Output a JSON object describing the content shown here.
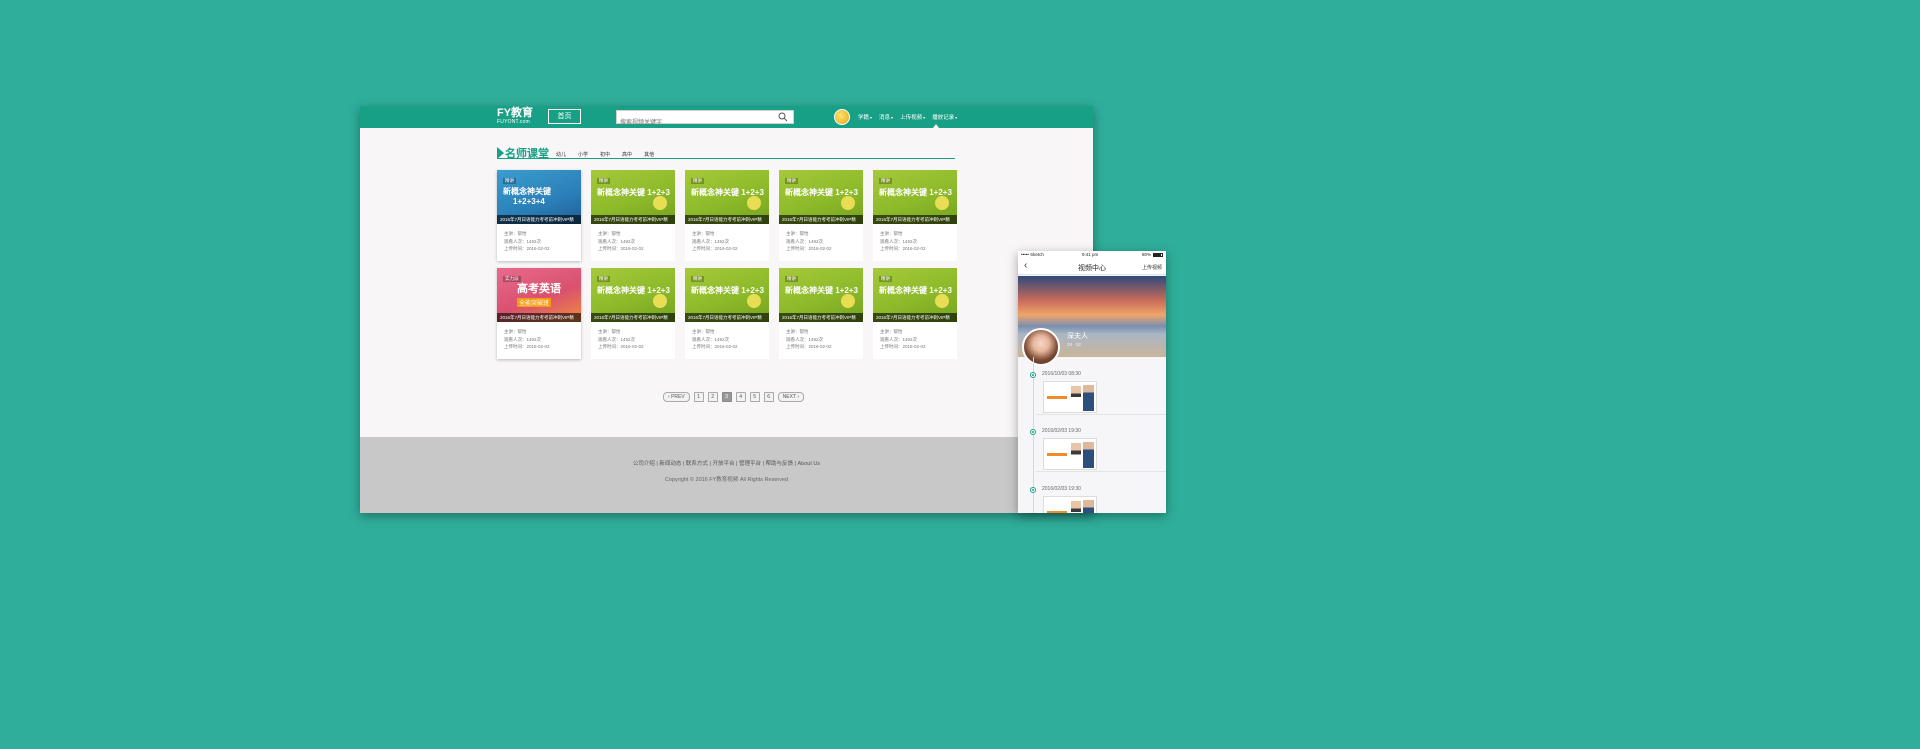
{
  "colors": {
    "background": "#2fae9b",
    "brand": "#17a085",
    "footer": "#c8c8c8"
  },
  "header": {
    "logo_main": "FY教育",
    "logo_sub": "FUYONT.com",
    "home_label": "首页",
    "search_placeholder": "搜索视频关键字",
    "nav": [
      {
        "label": "学籍"
      },
      {
        "label": "消息"
      },
      {
        "label": "上传视频"
      },
      {
        "label": "播放记录"
      }
    ]
  },
  "section": {
    "title": "名师课堂",
    "tabs": [
      "幼儿",
      "小学",
      "初中",
      "高中",
      "其他"
    ]
  },
  "card_caption": "2016年7月日语能力考考前冲刺VIP精",
  "cards": [
    {
      "theme": "blue",
      "tag": "精讲",
      "big": "新概念神关键",
      "big2": "1+2+3+4",
      "line1": "主讲：郁怡",
      "line2": "观看人次：1492次",
      "line3": "上传时间：2016-02-02"
    },
    {
      "theme": "green",
      "tag": "精讲",
      "big": "新概念神关键 1+2+3",
      "line1": "主讲：郁怡",
      "line2": "观看人次：1492次",
      "line3": "上传时间：2016-02-02"
    },
    {
      "theme": "green",
      "tag": "精讲",
      "big": "新概念神关键 1+2+3",
      "line1": "主讲：郁怡",
      "line2": "观看人次：1492次",
      "line3": "上传时间：2016-02-02"
    },
    {
      "theme": "green",
      "tag": "精讲",
      "big": "新概念神关键 1+2+3",
      "line1": "主讲：郁怡",
      "line2": "观看人次：1492次",
      "line3": "上传时间：2016-02-02"
    },
    {
      "theme": "green",
      "tag": "精讲",
      "big": "新概念神关键 1+2+3",
      "line1": "主讲：郁怡",
      "line2": "观看人次：1492次",
      "line3": "上传时间：2016-02-02"
    },
    {
      "theme": "pink",
      "tag": "实力派",
      "big": "高考英语",
      "big2": "全能突破班",
      "line1": "主讲：郁怡",
      "line2": "观看人次：1492次",
      "line3": "上传时间：2016-02-02"
    },
    {
      "theme": "green",
      "tag": "精讲",
      "big": "新概念神关键 1+2+3",
      "line1": "主讲：郁怡",
      "line2": "观看人次：1492次",
      "line3": "上传时间：2016-02-02"
    },
    {
      "theme": "green",
      "tag": "精讲",
      "big": "新概念神关键 1+2+3",
      "line1": "主讲：郁怡",
      "line2": "观看人次：1492次",
      "line3": "上传时间：2016-02-02"
    },
    {
      "theme": "green",
      "tag": "精讲",
      "big": "新概念神关键 1+2+3",
      "line1": "主讲：郁怡",
      "line2": "观看人次：1492次",
      "line3": "上传时间：2016-02-02"
    },
    {
      "theme": "green",
      "tag": "精讲",
      "big": "新概念神关键 1+2+3",
      "line1": "主讲：郁怡",
      "line2": "观看人次：1492次",
      "line3": "上传时间：2016-02-02"
    }
  ],
  "pagination": {
    "prev": "PREV",
    "pages": [
      "1",
      "2",
      "3",
      "4",
      "5",
      "6"
    ],
    "active_page": "3",
    "next": "NEXT"
  },
  "footer": {
    "links": [
      "公司介绍",
      "新闻动态",
      "联系方式",
      "开放平台",
      "管理平台",
      "帮助与反馈",
      "About Us"
    ],
    "copyright": "Copyright © 2016 FY教育视频 All Rights Reserved"
  },
  "mobile": {
    "carrier": "••••• Sketch",
    "time": "9:41 pm",
    "battery": "80%",
    "title": "视频中心",
    "upload": "上传视频",
    "user_name": "深夫人",
    "user_sub": "28 · 52",
    "timeline": [
      {
        "time": "2016/10/03 08:30"
      },
      {
        "time": "2016/02/03 19:30"
      },
      {
        "time": "2016/02/03 19:30"
      }
    ]
  }
}
